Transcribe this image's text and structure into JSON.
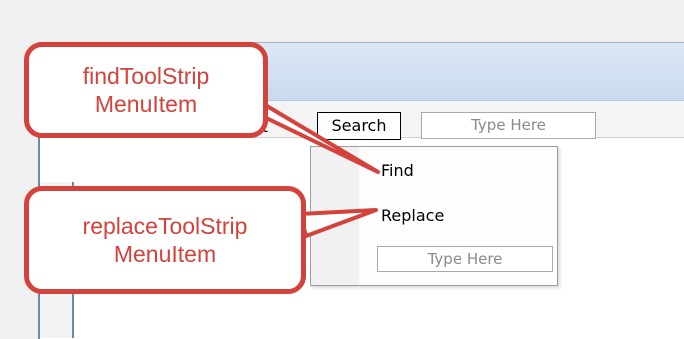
{
  "menu": {
    "edit_fragment": "it",
    "search_label": "Search",
    "type_here_placeholder": "Type Here"
  },
  "dropdown": {
    "items": [
      {
        "label": "Find"
      },
      {
        "label": "Replace"
      }
    ],
    "type_here_placeholder": "Type Here"
  },
  "callouts": {
    "find": {
      "line1": "findToolStrip",
      "line2": "MenuItem"
    },
    "replace": {
      "line1": "replaceToolStrip",
      "line2": "MenuItem"
    }
  },
  "colors": {
    "callout_accent": "#d3423b",
    "title_bar": "#c9d9ee"
  }
}
